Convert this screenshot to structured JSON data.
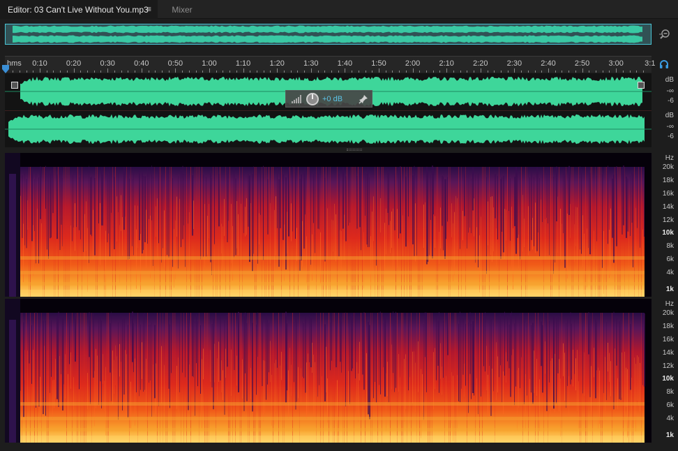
{
  "tabs": {
    "editor_label": "Editor: 03 Can't Live Without You.mp3",
    "editor_menu_icon": "≡",
    "mixer_label": "Mixer"
  },
  "ruler": {
    "unit_label": "hms",
    "ticks": [
      "0:10",
      "0:20",
      "0:30",
      "0:40",
      "0:50",
      "1:00",
      "1:10",
      "1:20",
      "1:30",
      "1:40",
      "1:50",
      "2:00",
      "2:10",
      "2:20",
      "2:30",
      "2:40",
      "2:50",
      "3:00",
      "3:1"
    ]
  },
  "waveform": {
    "color": "#3ed69a",
    "channels": [
      {
        "scale": [
          "dB",
          "-∞",
          "-6"
        ]
      },
      {
        "scale": [
          "dB",
          "-∞",
          "-6"
        ]
      }
    ]
  },
  "hud": {
    "gain_label": "+0 dB"
  },
  "spectral": {
    "hz_label": "Hz",
    "labels": [
      "20k",
      "18k",
      "16k",
      "14k",
      "12k",
      "10k",
      "8k",
      "6k",
      "4k",
      "1k"
    ]
  },
  "icons": {
    "zoom": "zoom-out-icon",
    "headphone": "headphone-icon",
    "playhead": "playhead-marker-icon",
    "pin": "pin-icon",
    "knob": "volume-knob-icon"
  },
  "colors": {
    "accent": "#49c6d6",
    "hud_text": "#5cc3e6",
    "spectrum_low": "#ffe070",
    "spectrum_mid": "#e02a20",
    "spectrum_high": "#3c1a5c"
  }
}
